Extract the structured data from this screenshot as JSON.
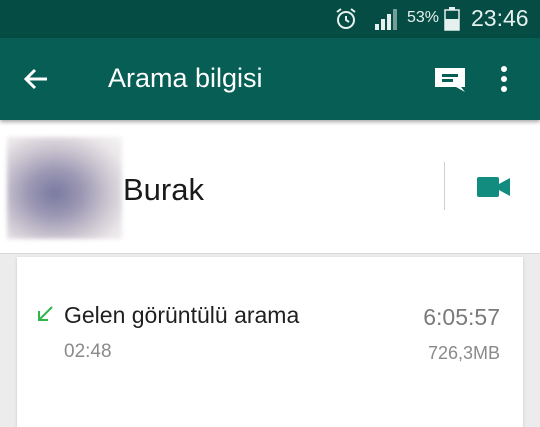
{
  "status_bar": {
    "icons": [
      "alarm-icon",
      "signal-icon",
      "battery-icon"
    ],
    "battery_percent": "53%",
    "time": "23:46"
  },
  "app_bar": {
    "title": "Arama bilgisi",
    "icons": [
      "back-arrow-icon",
      "message-icon",
      "more-vert-icon"
    ],
    "color": "#075e54"
  },
  "contact": {
    "name": "Burak",
    "action_icon": "video-call-icon",
    "accent": "#128c7e"
  },
  "calls": [
    {
      "direction_icon": "incoming-arrow-icon",
      "type": "Gelen görüntülü arama",
      "time": "6:05:57",
      "duration": "02:48",
      "data_size": "726,3MB"
    }
  ]
}
